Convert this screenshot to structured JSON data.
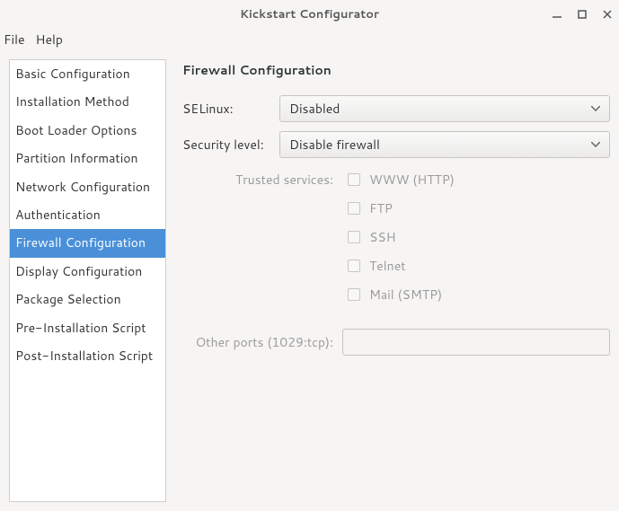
{
  "window": {
    "title": "Kickstart Configurator"
  },
  "menu": {
    "file": "File",
    "help": "Help"
  },
  "sidebar": {
    "items": [
      {
        "label": "Basic Configuration"
      },
      {
        "label": "Installation Method"
      },
      {
        "label": "Boot Loader Options"
      },
      {
        "label": "Partition Information"
      },
      {
        "label": "Network Configuration"
      },
      {
        "label": "Authentication"
      },
      {
        "label": "Firewall Configuration"
      },
      {
        "label": "Display Configuration"
      },
      {
        "label": "Package Selection"
      },
      {
        "label": "Pre-Installation Script"
      },
      {
        "label": "Post-Installation Script"
      }
    ],
    "selected_index": 6
  },
  "page": {
    "title": "Firewall Configuration",
    "selinux_label": "SELinux:",
    "selinux_value": "Disabled",
    "seclevel_label": "Security level:",
    "seclevel_value": "Disable firewall",
    "trusted_label": "Trusted services:",
    "services": [
      {
        "label": "WWW (HTTP)",
        "checked": false
      },
      {
        "label": "FTP",
        "checked": false
      },
      {
        "label": "SSH",
        "checked": false
      },
      {
        "label": "Telnet",
        "checked": false
      },
      {
        "label": "Mail (SMTP)",
        "checked": false
      }
    ],
    "other_ports_label": "Other ports (1029:tcp):",
    "other_ports_value": ""
  }
}
